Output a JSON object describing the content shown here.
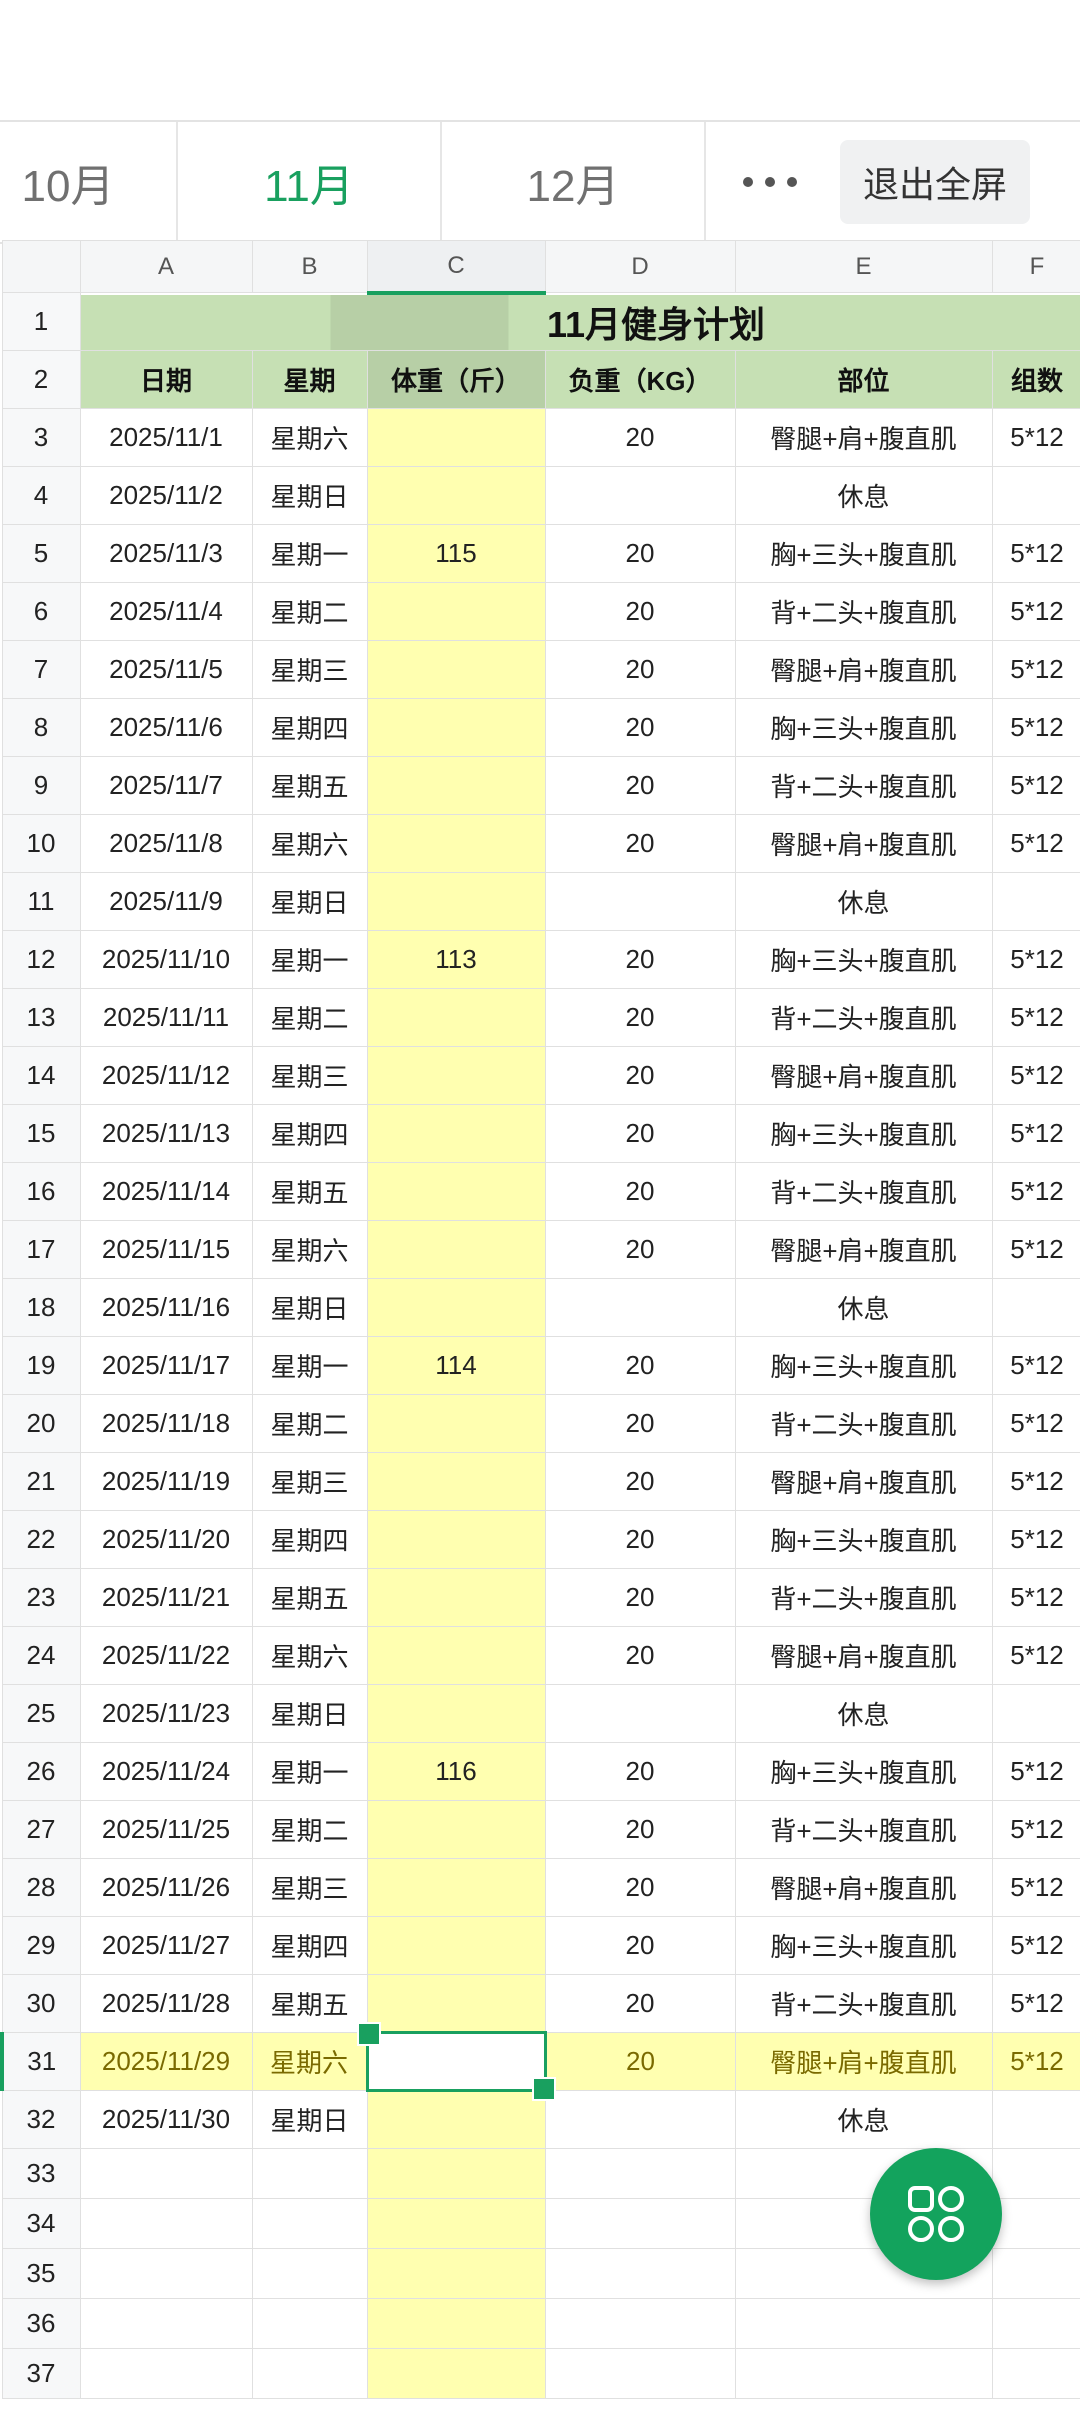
{
  "tabs": [
    "10月",
    "11月",
    "12月"
  ],
  "exit_label": "退出全屏",
  "columns": [
    "A",
    "B",
    "C",
    "D",
    "E",
    "F"
  ],
  "title": "11月健身计划",
  "headers": [
    "日期",
    "星期",
    "体重（斤）",
    "负重（KG）",
    "部位",
    "组数"
  ],
  "rows": [
    [
      "2025/11/1",
      "星期六",
      "",
      "20",
      "臀腿+肩+腹直肌",
      "5*12"
    ],
    [
      "2025/11/2",
      "星期日",
      "",
      "",
      "休息",
      ""
    ],
    [
      "2025/11/3",
      "星期一",
      "115",
      "20",
      "胸+三头+腹直肌",
      "5*12"
    ],
    [
      "2025/11/4",
      "星期二",
      "",
      "20",
      "背+二头+腹直肌",
      "5*12"
    ],
    [
      "2025/11/5",
      "星期三",
      "",
      "20",
      "臀腿+肩+腹直肌",
      "5*12"
    ],
    [
      "2025/11/6",
      "星期四",
      "",
      "20",
      "胸+三头+腹直肌",
      "5*12"
    ],
    [
      "2025/11/7",
      "星期五",
      "",
      "20",
      "背+二头+腹直肌",
      "5*12"
    ],
    [
      "2025/11/8",
      "星期六",
      "",
      "20",
      "臀腿+肩+腹直肌",
      "5*12"
    ],
    [
      "2025/11/9",
      "星期日",
      "",
      "",
      "休息",
      ""
    ],
    [
      "2025/11/10",
      "星期一",
      "113",
      "20",
      "胸+三头+腹直肌",
      "5*12"
    ],
    [
      "2025/11/11",
      "星期二",
      "",
      "20",
      "背+二头+腹直肌",
      "5*12"
    ],
    [
      "2025/11/12",
      "星期三",
      "",
      "20",
      "臀腿+肩+腹直肌",
      "5*12"
    ],
    [
      "2025/11/13",
      "星期四",
      "",
      "20",
      "胸+三头+腹直肌",
      "5*12"
    ],
    [
      "2025/11/14",
      "星期五",
      "",
      "20",
      "背+二头+腹直肌",
      "5*12"
    ],
    [
      "2025/11/15",
      "星期六",
      "",
      "20",
      "臀腿+肩+腹直肌",
      "5*12"
    ],
    [
      "2025/11/16",
      "星期日",
      "",
      "",
      "休息",
      ""
    ],
    [
      "2025/11/17",
      "星期一",
      "114",
      "20",
      "胸+三头+腹直肌",
      "5*12"
    ],
    [
      "2025/11/18",
      "星期二",
      "",
      "20",
      "背+二头+腹直肌",
      "5*12"
    ],
    [
      "2025/11/19",
      "星期三",
      "",
      "20",
      "臀腿+肩+腹直肌",
      "5*12"
    ],
    [
      "2025/11/20",
      "星期四",
      "",
      "20",
      "胸+三头+腹直肌",
      "5*12"
    ],
    [
      "2025/11/21",
      "星期五",
      "",
      "20",
      "背+二头+腹直肌",
      "5*12"
    ],
    [
      "2025/11/22",
      "星期六",
      "",
      "20",
      "臀腿+肩+腹直肌",
      "5*12"
    ],
    [
      "2025/11/23",
      "星期日",
      "",
      "",
      "休息",
      ""
    ],
    [
      "2025/11/24",
      "星期一",
      "116",
      "20",
      "胸+三头+腹直肌",
      "5*12"
    ],
    [
      "2025/11/25",
      "星期二",
      "",
      "20",
      "背+二头+腹直肌",
      "5*12"
    ],
    [
      "2025/11/26",
      "星期三",
      "",
      "20",
      "臀腿+肩+腹直肌",
      "5*12"
    ],
    [
      "2025/11/27",
      "星期四",
      "",
      "20",
      "胸+三头+腹直肌",
      "5*12"
    ],
    [
      "2025/11/28",
      "星期五",
      "",
      "20",
      "背+二头+腹直肌",
      "5*12"
    ],
    [
      "2025/11/29",
      "星期六",
      "",
      "20",
      "臀腿+肩+腹直肌",
      "5*12"
    ],
    [
      "2025/11/30",
      "星期日",
      "",
      "",
      "休息",
      ""
    ]
  ],
  "empty_row_numbers": [
    "33",
    "34",
    "35",
    "36",
    "37"
  ],
  "colors": {
    "accent": "#19a05f",
    "header_fill": "#c6e0b4",
    "highlight_fill": "#ffffb0"
  },
  "icons": {
    "fab": "apps-grid-icon",
    "more": "more-dots-icon"
  }
}
